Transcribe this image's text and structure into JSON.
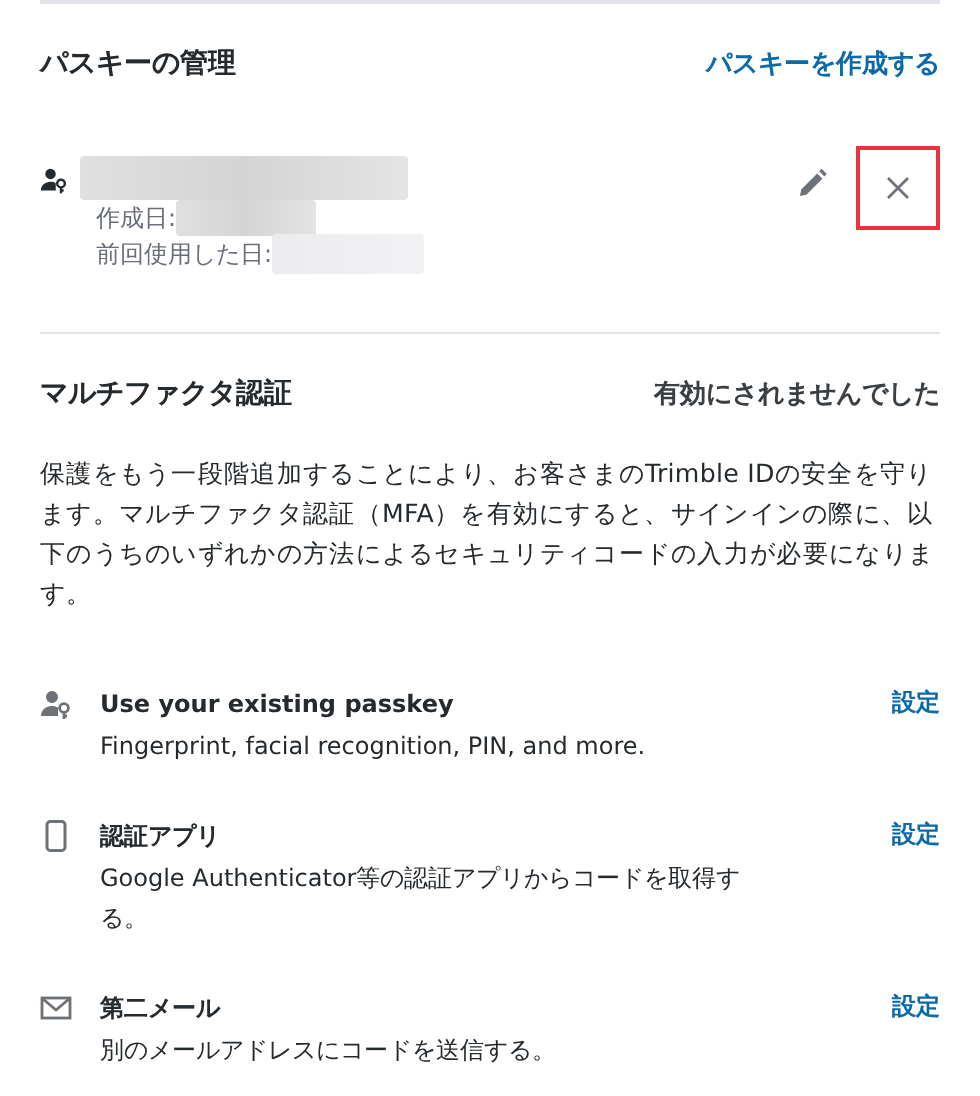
{
  "passkeys": {
    "title": "パスキーの管理",
    "create_link": "パスキーを作成する",
    "items": [
      {
        "created_label": "作成日:",
        "last_used_label": "前回使用した日:",
        "name_redacted": true,
        "delete_highlighted": true
      }
    ]
  },
  "mfa": {
    "title": "マルチファクタ認証",
    "status": "有効にされませんでした",
    "description": "保護をもう一段階追加することにより、お客さまのTrimble IDの安全を守ります。マルチファクタ認証（MFA）を有効にすると、サインインの際に、以下のうちのいずれかの方法によるセキュリティコードの入力が必要になります。",
    "methods": [
      {
        "kind": "passkey",
        "title": "Use your existing passkey",
        "subtitle": "Fingerprint, facial recognition, PIN, and more.",
        "action": "設定"
      },
      {
        "kind": "app",
        "title": "認証アプリ",
        "subtitle": "Google Authenticator等の認証アプリからコードを取得する。",
        "action": "設定"
      },
      {
        "kind": "email",
        "title": "第二メール",
        "subtitle": "別のメールアドレスにコードを送信する。",
        "action": "設定"
      }
    ]
  }
}
